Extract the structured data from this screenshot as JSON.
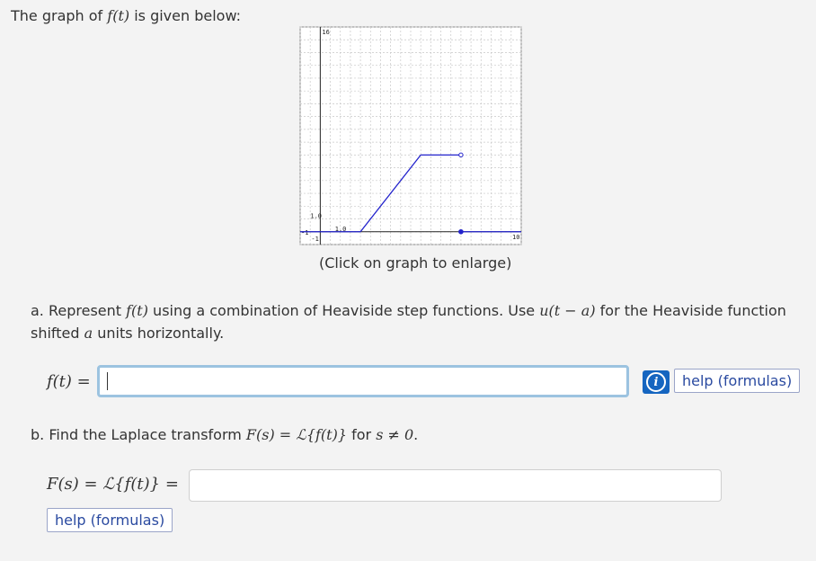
{
  "intro": {
    "before": "The graph of ",
    "func": "f(t)",
    "after": " is given below:"
  },
  "chart_data": {
    "type": "line",
    "tick_labels": {
      "y_top": "16",
      "y_mid": "1.0",
      "x_neg": "-1",
      "y_neg": "-1",
      "x_mid": "1.0",
      "x_right": "10"
    },
    "xlim": [
      -1,
      10
    ],
    "ylim": [
      -1,
      16
    ],
    "grid": true,
    "segments": [
      {
        "x": [
          -1,
          2
        ],
        "y": [
          0,
          0
        ]
      },
      {
        "x": [
          2,
          5
        ],
        "y": [
          0,
          6
        ]
      },
      {
        "x": [
          5,
          7
        ],
        "y": [
          6,
          6
        ]
      },
      {
        "x": [
          7,
          10
        ],
        "y": [
          0,
          0
        ]
      }
    ],
    "open_points": [
      {
        "x": 7,
        "y": 6
      }
    ],
    "closed_points": [
      {
        "x": 7,
        "y": 0
      }
    ],
    "line_color": "#2222cc"
  },
  "caption": "(Click on graph to enlarge)",
  "part_a": {
    "text1": "a. Represent ",
    "f": "f(t)",
    "text2": " using a combination of Heaviside step functions. Use ",
    "u": "u(t − a)",
    "text3": " for the Heaviside function shifted ",
    "a": "a",
    "text4": " units horizontally.",
    "label": "f(t) =",
    "input_value": "",
    "help": "help (formulas)"
  },
  "part_b": {
    "text1": "b. Find the Laplace transform ",
    "expr": "F(s) = ℒ{f(t)}",
    "text2": " for ",
    "cond": "s ≠ 0",
    "text3": ".",
    "label": "F(s) = ℒ{f(t)} =",
    "input_value": "",
    "help": "help (formulas)"
  },
  "colors": {
    "accent": "#1565c0",
    "focus_border": "#9cc3e0",
    "help_text": "#2a4aa0"
  }
}
